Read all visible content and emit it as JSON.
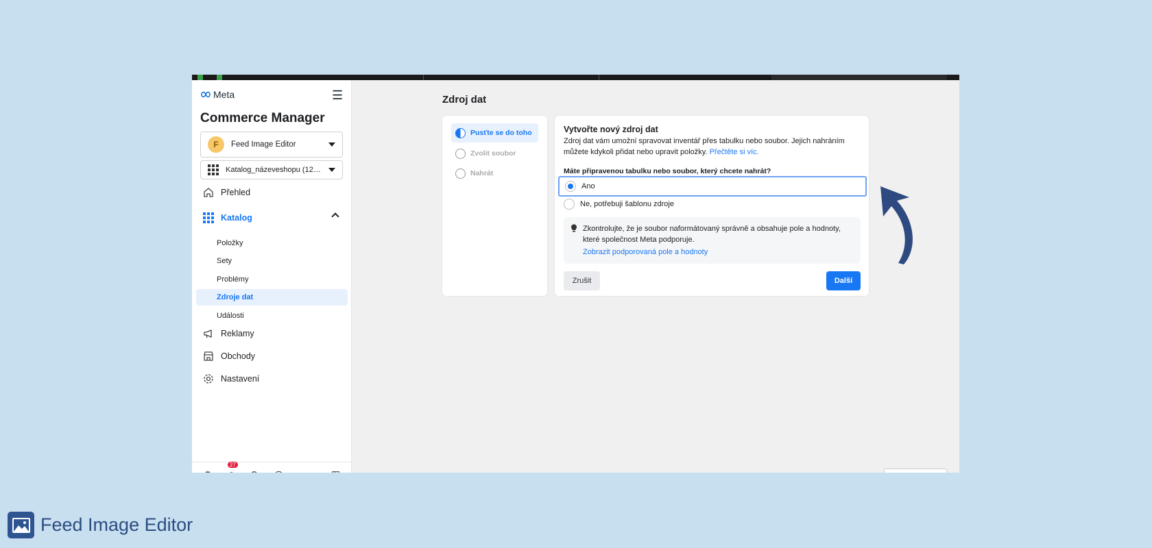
{
  "sidebar": {
    "brand": "Meta",
    "app_title": "Commerce Manager",
    "business": {
      "initial": "F",
      "name": "Feed Image Editor"
    },
    "catalog": {
      "name": "Katalog_názeveshopu (1226..."
    },
    "nav": {
      "overview": "Přehled",
      "catalog": "Katalog",
      "catalog_items": [
        "Položky",
        "Sety",
        "Problémy",
        "Zdroje dat",
        "Události"
      ],
      "ads": "Reklamy",
      "shops": "Obchody",
      "settings": "Nastavení"
    },
    "notifications_count": "27"
  },
  "main": {
    "page_title": "Zdroj dat",
    "steps": [
      "Pusťte se do toho",
      "Zvolit soubor",
      "Nahrát"
    ],
    "card": {
      "title": "Vytvořte nový zdroj dat",
      "description": "Zdroj dat vám umožní spravovat inventář přes tabulku nebo soubor. Jejich nahráním můžete kdykoli přidat nebo upravit položky.",
      "read_more": "Přečtěte si víc.",
      "question": "Máte připravenou tabulku nebo soubor, který chcete nahrát?",
      "options": [
        "Ano",
        "Ne, potřebuji šablonu zdroje"
      ],
      "selected_option": "Ano",
      "info_text": "Zkontrolujte, že je soubor naformátovaný správně a obsahuje pole a hodnoty, které společnost Meta podporuje.",
      "info_link": "Zobrazit podporovaná pole a hodnoty",
      "cancel_label": "Zrušit",
      "next_label": "Další"
    }
  },
  "footer": {
    "brand_name": "Feed Image Editor"
  },
  "colors": {
    "accent": "#1877f2",
    "background": "#c8dff0",
    "arrow": "#2e4a80"
  }
}
